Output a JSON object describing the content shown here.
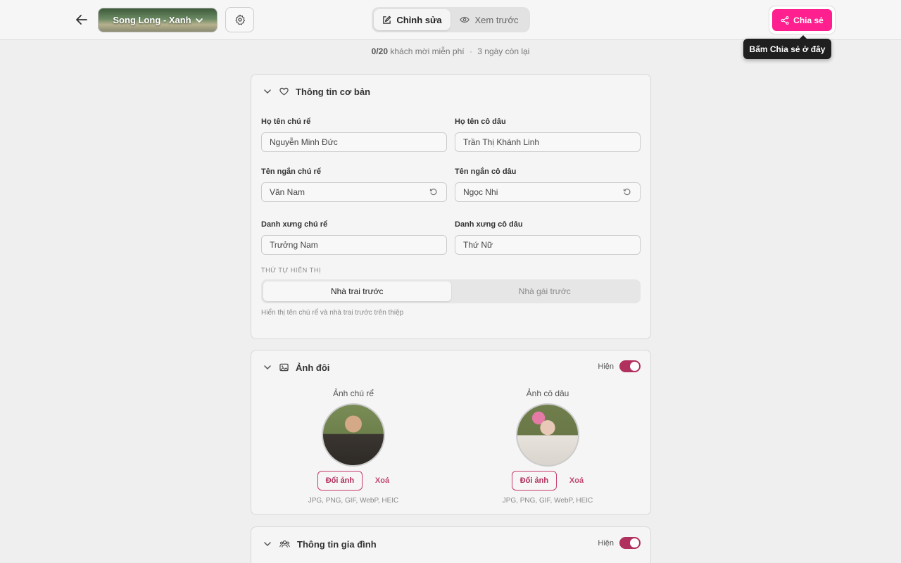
{
  "header": {
    "template_name": "Song Long - Xanh",
    "mode_edit": "Chỉnh sửa",
    "mode_preview": "Xem trước",
    "share_label": "Chia sẻ",
    "tooltip": "Bấm Chia sẻ ở đây",
    "accent": "#ff1f8e"
  },
  "guests": {
    "count": "0/20",
    "text": "khách mời miễn phí",
    "separator": "·",
    "days_left": "3 ngày còn lại"
  },
  "basic_info": {
    "title": "Thông tin cơ bản",
    "groom_name_label": "Họ tên chú rể",
    "groom_name": "Nguyễn Minh Đức",
    "bride_name_label": "Họ tên cô dâu",
    "bride_name": "Trần Thị Khánh Linh",
    "groom_short_label": "Tên ngắn chú rể",
    "groom_short": "Văn Nam",
    "bride_short_label": "Tên ngắn cô dâu",
    "bride_short": "Ngọc Nhi",
    "groom_title_label": "Danh xưng chú rể",
    "groom_title": "Trưởng Nam",
    "bride_title_label": "Danh xưng cô dâu",
    "bride_title": "Thứ Nữ",
    "order_label": "THỨ TỰ HIỂN THỊ",
    "order_groom_first": "Nhà trai trước",
    "order_bride_first": "Nhà gái trước",
    "order_hint": "Hiển thị tên chú rể và nhà trai trước trên thiệp"
  },
  "couple_photo": {
    "title": "Ảnh đôi",
    "visibility_label": "Hiện",
    "groom_photo_label": "Ảnh chú rể",
    "bride_photo_label": "Ảnh cô dâu",
    "change_label": "Đổi ảnh",
    "delete_label": "Xoá",
    "formats": "JPG, PNG, GIF, WebP, HEIC"
  },
  "family_info": {
    "title": "Thông tin gia đình",
    "visibility_label": "Hiện"
  }
}
